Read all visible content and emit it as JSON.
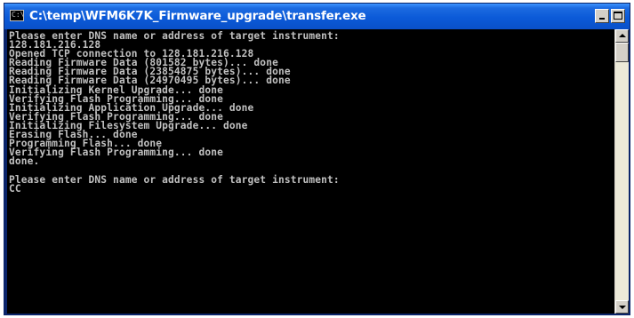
{
  "window": {
    "title": "C:\\temp\\WFM6K7K_Firmware_upgrade\\transfer.exe",
    "icon": "console-window-icon",
    "icon_glyph": "C:\\",
    "controls": {
      "minimize": "minimize-icon",
      "maximize": "maximize-icon"
    }
  },
  "console": {
    "lines": [
      "Please enter DNS name or address of target instrument:",
      "128.181.216.128",
      "Opened TCP connection to 128.181.216.128",
      "Reading Firmware Data (801582 bytes)... done",
      "Reading Firmware Data (23854875 bytes)... done",
      "Reading Firmware Data (24970495 bytes)... done",
      "Initializing Kernel Upgrade... done",
      "Verifying Flash Programming... done",
      "Initializing Application Upgrade... done",
      "Verifying Flash Programming... done",
      "Initializing Filesystem Upgrade... done",
      "Erasing Flash... done",
      "Programming Flash... done",
      "Verifying Flash Programming... done",
      "done.",
      "",
      "Please enter DNS name or address of target instrument:",
      "CC"
    ],
    "text_color": "#c0c0c0",
    "background_color": "#000000"
  },
  "colors": {
    "titlebar": "#0b5ad8",
    "title_text": "#ffffff",
    "chrome": "#d4d0c8"
  }
}
